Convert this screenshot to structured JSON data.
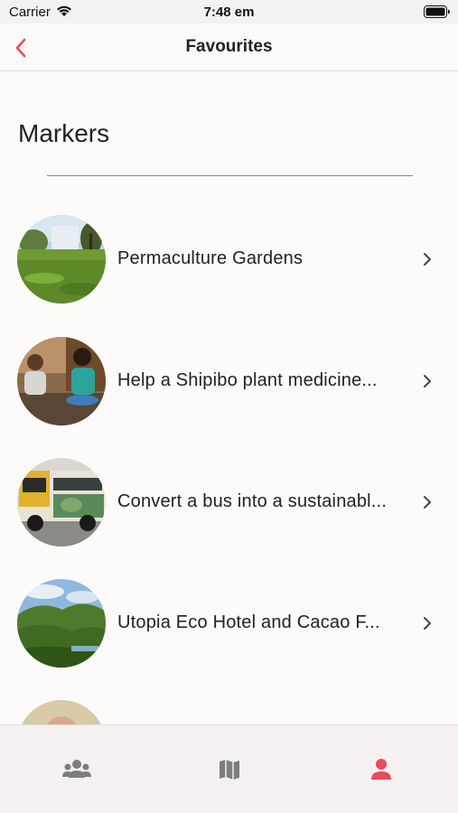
{
  "status_bar": {
    "carrier": "Carrier",
    "time": "7:48 em"
  },
  "nav": {
    "title": "Favourites",
    "back_icon": "chevron-left-icon"
  },
  "section": {
    "title": "Markers"
  },
  "markers": [
    {
      "label": "Permaculture Gardens"
    },
    {
      "label": "Help a Shipibo plant medicine..."
    },
    {
      "label": "Convert a bus into a sustainabl..."
    },
    {
      "label": "Utopia Eco Hotel and Cacao F..."
    },
    {
      "label": ""
    }
  ],
  "tabs": [
    {
      "name": "community",
      "icon": "users-icon"
    },
    {
      "name": "map",
      "icon": "map-icon"
    },
    {
      "name": "profile",
      "icon": "user-icon",
      "active": true
    }
  ],
  "colors": {
    "accent": "#e94b5b",
    "tab_inactive": "#7d7d7d",
    "text": "#222222"
  }
}
